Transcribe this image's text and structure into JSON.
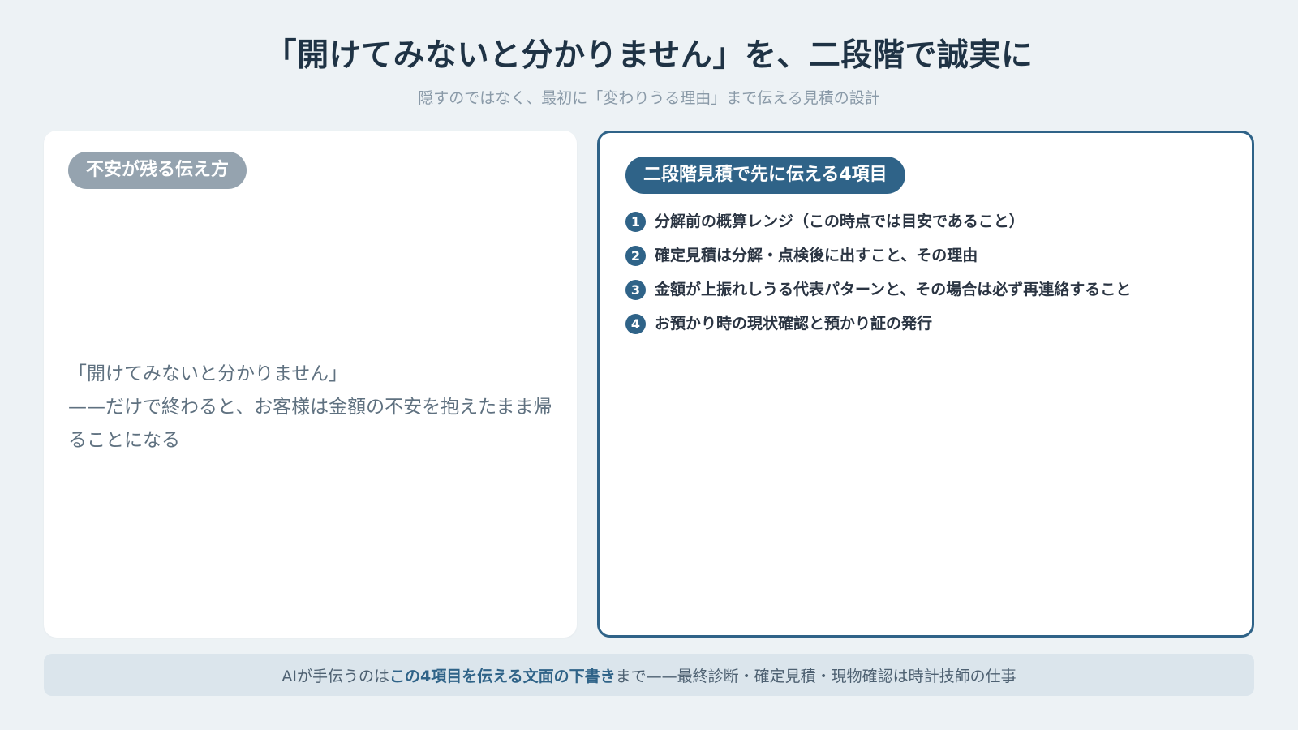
{
  "header": {
    "title": "「開けてみないと分かりません」を、二段階で誠実に",
    "subtitle": "隠すのではなく、最初に「変わりうる理由」まで伝える見積の設計"
  },
  "left_card": {
    "badge": "不安が残る伝え方",
    "quote_line_1": "「開けてみないと分かりません」",
    "quote_line_2": "——だけで終わると、お客様は金額の不安を抱えたまま帰ることになる"
  },
  "right_card": {
    "badge": "二段階見積で先に伝える4項目",
    "items": [
      {
        "number": "1",
        "text": "分解前の概算レンジ（この時点では目安であること）"
      },
      {
        "number": "2",
        "text": "確定見積は分解・点検後に出すこと、その理由"
      },
      {
        "number": "3",
        "text": "金額が上振れしうる代表パターンと、その場合は必ず再連絡すること"
      },
      {
        "number": "4",
        "text": "お預かり時の現状確認と預かり証の発行"
      }
    ]
  },
  "footer": {
    "prefix": "AIが手伝うのは",
    "highlight": "この4項目を伝える文面の下書き",
    "suffix": "まで——最終診断・確定見積・現物確認は時計技師の仕事"
  },
  "colors": {
    "background": "#edf2f5",
    "accent_blue": "#2f6388",
    "muted_gray": "#95a3af",
    "title_text": "#1f3345",
    "footer_bg": "#dbe5ec"
  }
}
